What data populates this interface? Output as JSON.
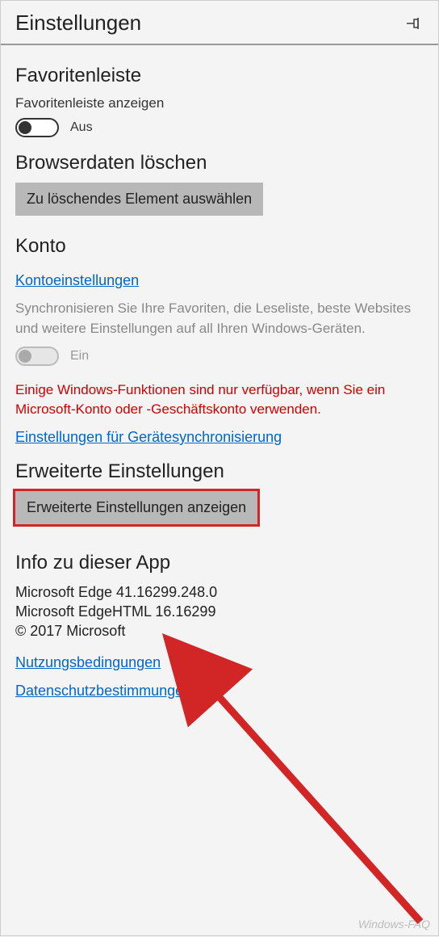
{
  "header": {
    "title": "Einstellungen"
  },
  "favorites": {
    "heading": "Favoritenleiste",
    "toggle_label": "Favoritenleiste anzeigen",
    "toggle_state": "Aus"
  },
  "browserdata": {
    "heading": "Browserdaten löschen",
    "button": "Zu löschendes Element auswählen"
  },
  "account": {
    "heading": "Konto",
    "settings_link": "Kontoeinstellungen",
    "sync_description": "Synchronisieren Sie Ihre Favoriten, die Leseliste, beste Websites und weitere Einstellungen auf all Ihren Windows-Geräten.",
    "sync_toggle_state": "Ein",
    "warning": "Einige Windows-Funktionen sind nur verfügbar, wenn Sie ein Microsoft-Konto oder -Geschäftskonto verwenden.",
    "device_sync_link": "Einstellungen für Gerätesynchronisierung"
  },
  "advanced": {
    "heading": "Erweiterte Einstellungen",
    "button": "Erweiterte Einstellungen anzeigen"
  },
  "about": {
    "heading": "Info zu dieser App",
    "line1": "Microsoft Edge 41.16299.248.0",
    "line2": "Microsoft EdgeHTML 16.16299",
    "line3": "© 2017 Microsoft",
    "terms_link": "Nutzungsbedingungen",
    "privacy_link": "Datenschutzbestimmungen"
  },
  "watermark": "Windows-FAQ"
}
